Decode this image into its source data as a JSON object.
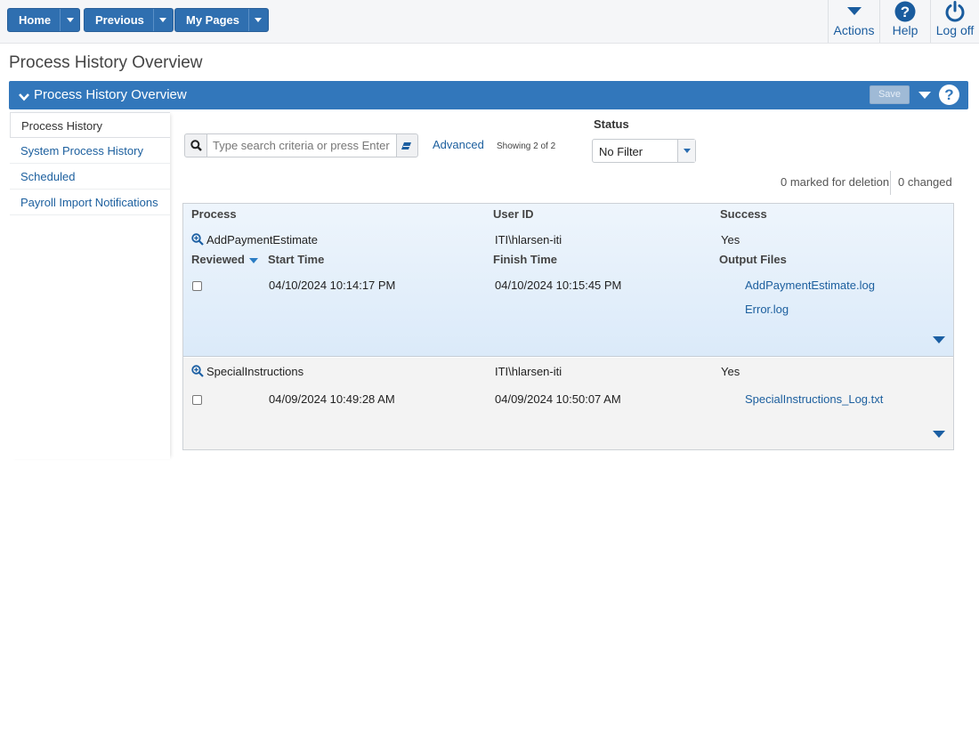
{
  "topbar": {
    "home_label": "Home",
    "previous_label": "Previous",
    "mypages_label": "My Pages",
    "actions_label": "Actions",
    "help_label": "Help",
    "logoff_label": "Log off"
  },
  "page": {
    "title": "Process History Overview"
  },
  "panel": {
    "title": "Process History Overview",
    "save_label": "Save",
    "help_glyph": "?"
  },
  "sidebar": {
    "items": [
      {
        "label": "Process History"
      },
      {
        "label": "System Process History"
      },
      {
        "label": "Scheduled"
      },
      {
        "label": "Payroll Import Notifications"
      }
    ]
  },
  "search": {
    "placeholder": "Type search criteria or press Enter",
    "advanced_label": "Advanced",
    "showing": "Showing 2 of 2"
  },
  "status_filter": {
    "label": "Status",
    "value": "No Filter"
  },
  "summary": {
    "marked": "0 marked for deletion",
    "changed": "0 changed"
  },
  "columns": {
    "process": "Process",
    "user_id": "User ID",
    "success": "Success",
    "reviewed": "Reviewed",
    "start_time": "Start Time",
    "finish_time": "Finish Time",
    "output_files": "Output Files"
  },
  "rows": [
    {
      "process": "AddPaymentEstimate",
      "user_id": "ITI\\hlarsen-iti",
      "success": "Yes",
      "start_time": "04/10/2024 10:14:17 PM",
      "finish_time": "04/10/2024 10:15:45 PM",
      "output_files": [
        "AddPaymentEstimate.log",
        "Error.log"
      ]
    },
    {
      "process": "SpecialInstructions",
      "user_id": "ITI\\hlarsen-iti",
      "success": "Yes",
      "start_time": "04/09/2024 10:49:28 AM",
      "finish_time": "04/09/2024 10:50:07 AM",
      "output_files": [
        "SpecialInstructions_Log.txt"
      ]
    }
  ],
  "colors": {
    "brand_blue": "#3277bb",
    "link_blue": "#1c5f9e"
  },
  "icons": {
    "search": "search-icon",
    "clear": "eraser-icon",
    "zoom": "zoom-icon",
    "actions": "chevron-down-icon",
    "help": "help-icon",
    "logoff": "power-icon"
  }
}
